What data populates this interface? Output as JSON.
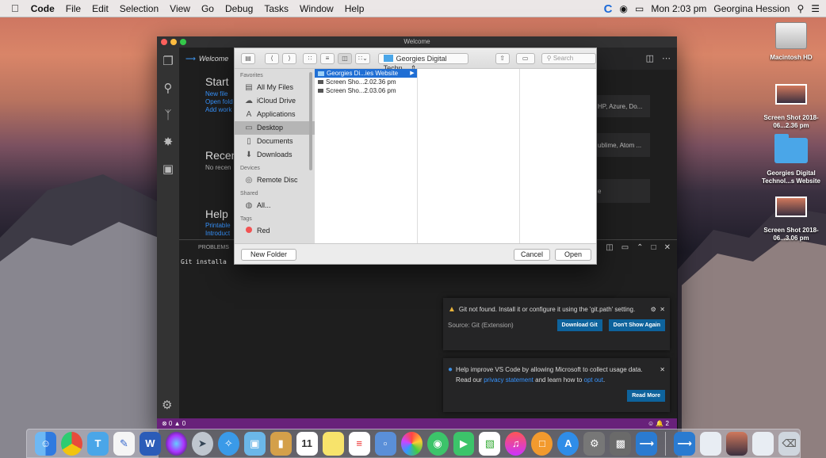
{
  "menubar": {
    "apple": "",
    "app": "Code",
    "items": [
      "File",
      "Edit",
      "Selection",
      "View",
      "Go",
      "Debug",
      "Tasks",
      "Window",
      "Help"
    ],
    "clock": "Mon 2:03 pm",
    "user": "Georgina Hession"
  },
  "desktop": {
    "items": [
      {
        "label": "Macintosh HD",
        "icon": "hard-drive-icon"
      },
      {
        "label": "Screen Shot 2018-06...2.36 pm",
        "icon": "screenshot-thumbnail"
      },
      {
        "label": "Georgies Digital Technol...s Website",
        "icon": "folder-icon"
      },
      {
        "label": "Screen Shot 2018-06...3.06 pm",
        "icon": "screenshot-thumbnail"
      }
    ]
  },
  "vscode": {
    "title": "Welcome",
    "tab": "Welcome",
    "start_heading": "Start",
    "start_links": [
      "New file",
      "Open fold",
      "Add work"
    ],
    "recent_heading": "Recen",
    "recent_text": "No recen",
    "help_heading": "Help",
    "help_links": [
      "Printable",
      "Introduct"
    ],
    "card1": "HP, Azure, Do...",
    "card2": "ublime, Atom ...",
    "card3": "e",
    "panel_tab": "PROBLEMS",
    "terminal_line": "Git installa",
    "status_left": "⊗ 0  ▲ 0",
    "status_right": "☺  🔔 2",
    "notifications": [
      {
        "type": "warning",
        "text": "Git not found. Install it or configure it using the 'git.path' setting.",
        "source": "Source: Git (Extension)",
        "buttons": [
          "Download Git",
          "Don't Show Again"
        ]
      },
      {
        "type": "info",
        "text_pre": "Help improve VS Code by allowing Microsoft to collect usage data. Read our ",
        "link1": "privacy statement",
        "text_mid": " and learn how to ",
        "link2": "opt out",
        "text_post": ".",
        "buttons": [
          "Read More"
        ]
      }
    ]
  },
  "dialog": {
    "location": "Georgies Digital Techn...",
    "search_placeholder": "Search",
    "sections": [
      {
        "header": "Favorites",
        "items": [
          {
            "label": "All My Files",
            "icon": "all-files-icon",
            "glyph": "▤"
          },
          {
            "label": "iCloud Drive",
            "icon": "cloud-icon",
            "glyph": "☁"
          },
          {
            "label": "Applications",
            "icon": "applications-icon",
            "glyph": "A"
          },
          {
            "label": "Desktop",
            "icon": "desktop-icon",
            "glyph": "▭",
            "selected": true
          },
          {
            "label": "Documents",
            "icon": "documents-icon",
            "glyph": "▯"
          },
          {
            "label": "Downloads",
            "icon": "downloads-icon",
            "glyph": "⬇"
          }
        ]
      },
      {
        "header": "Devices",
        "items": [
          {
            "label": "Remote Disc",
            "icon": "disc-icon",
            "glyph": "◎"
          }
        ]
      },
      {
        "header": "Shared",
        "items": [
          {
            "label": "All...",
            "icon": "network-icon",
            "glyph": "◍"
          }
        ]
      },
      {
        "header": "Tags",
        "items": [
          {
            "label": "Red",
            "icon": "red-tag-icon",
            "glyph": ""
          }
        ]
      }
    ],
    "files": [
      {
        "name": "Georgies Di...ies Website",
        "type": "folder",
        "selected": true
      },
      {
        "name": "Screen Sho...2.02.36 pm",
        "type": "file"
      },
      {
        "name": "Screen Sho...2.03.06 pm",
        "type": "file"
      }
    ],
    "new_folder": "New Folder",
    "cancel": "Cancel",
    "open": "Open"
  },
  "dock": {
    "apps": [
      "finder",
      "chrome",
      "system-preferences",
      "textedit",
      "word",
      "siri",
      "launchpad",
      "safari",
      "preview",
      "notes",
      "calendar",
      "stickies",
      "reminders",
      "keynote",
      "photos",
      "messages",
      "facetime",
      "numbers",
      "itunes",
      "ibooks",
      "app-store",
      "utility",
      "vscode"
    ],
    "right": [
      "vscode-doc",
      "screenshot-1",
      "screenshot-2",
      "screenshot-3",
      "trash"
    ]
  },
  "colors": {
    "accent": "#1f6ed4",
    "vscode_status": "#68217a",
    "button": "#0e639c"
  }
}
